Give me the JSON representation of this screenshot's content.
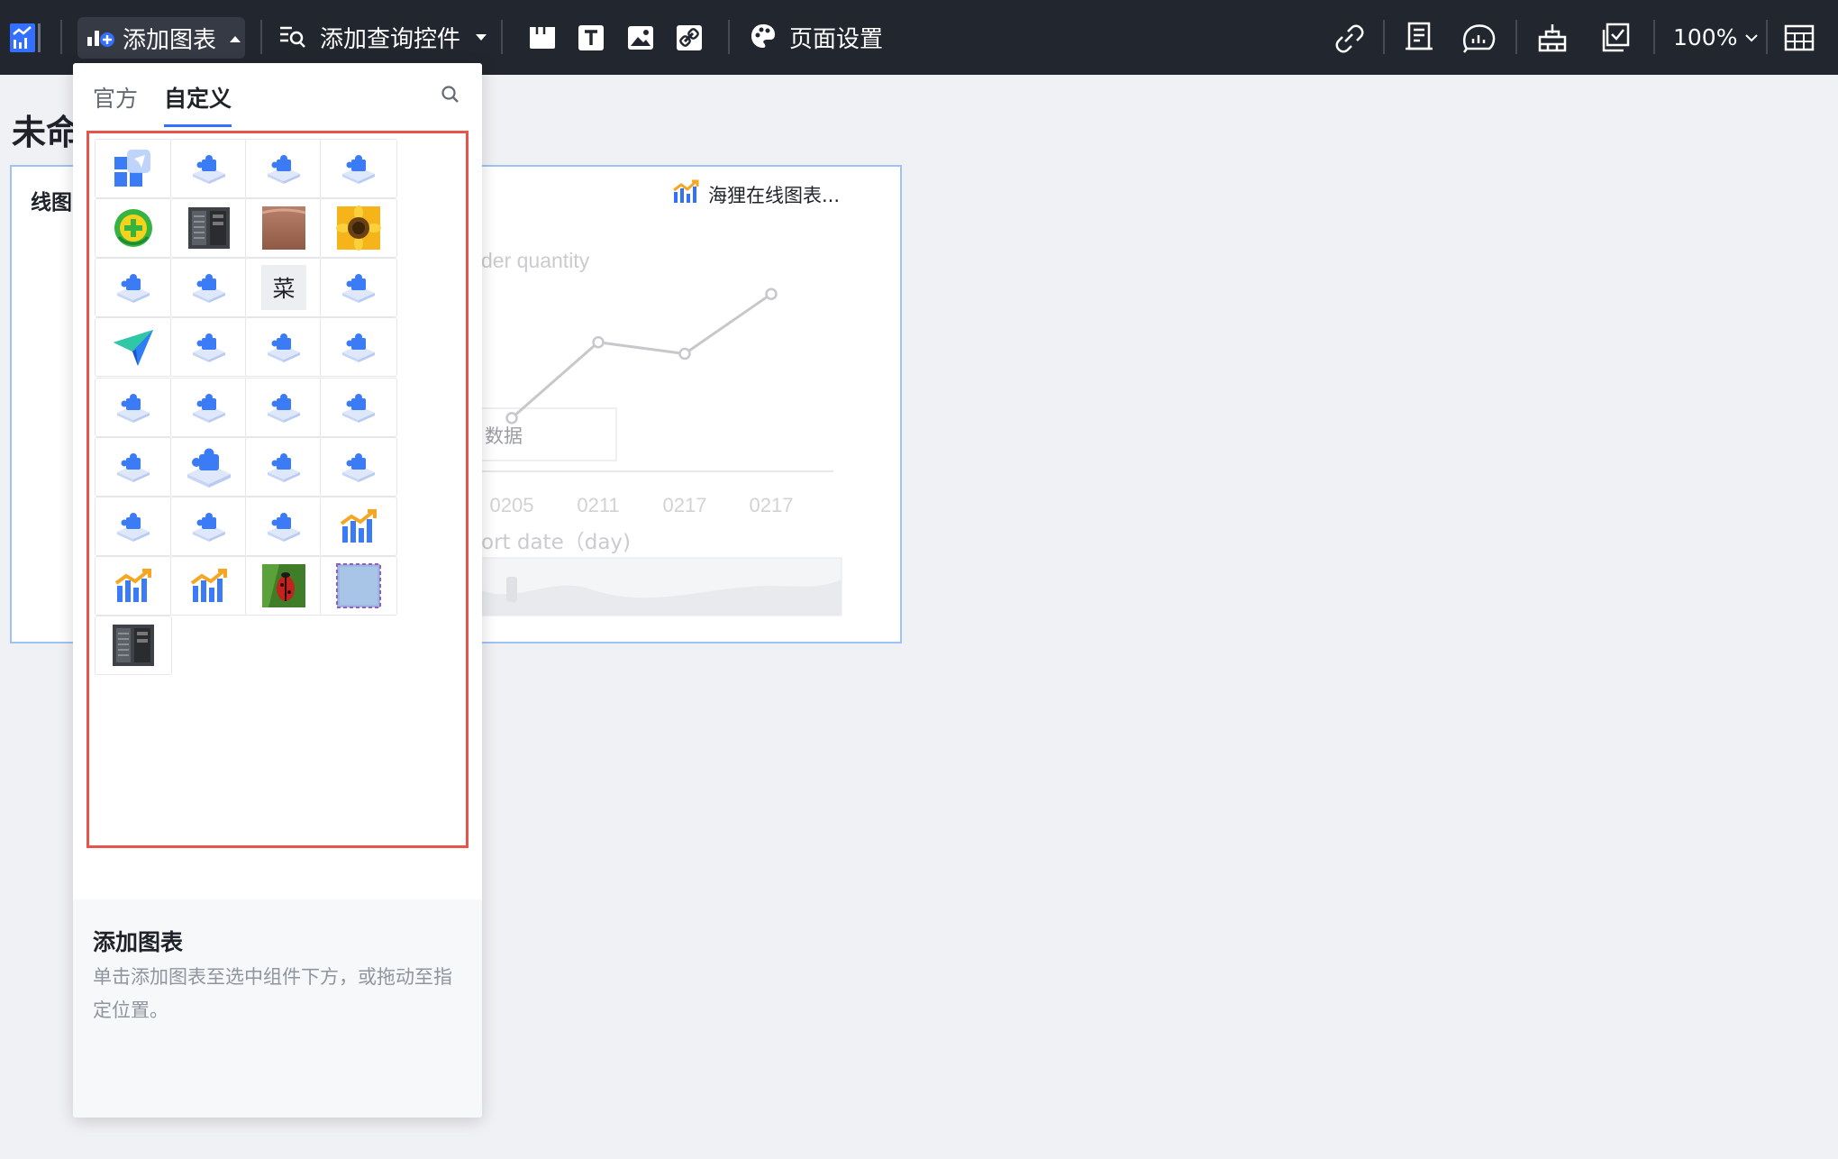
{
  "toolbar": {
    "add_chart_label": "添加图表",
    "add_query_label": "添加查询控件",
    "page_settings_label": "页面设置",
    "zoom": "100%"
  },
  "canvas": {
    "report_title": "未命",
    "card_title": "线图",
    "card_source": "海狸在线图表..."
  },
  "chart_data": {
    "type": "line",
    "title": "",
    "ylabel": "der quantity",
    "xlabel": "ort date（day)",
    "categories": [
      "0205",
      "0211",
      "0217",
      "0217"
    ],
    "values": [
      22,
      55,
      50,
      76
    ],
    "ylim": [
      0,
      100
    ],
    "annotation": "数据",
    "grid": false,
    "legend": "none"
  },
  "panel": {
    "tabs": [
      {
        "label": "官方",
        "active": false
      },
      {
        "label": "自定义",
        "active": true
      }
    ],
    "tiles": [
      {
        "icon": "custom-blocks-icon"
      },
      {
        "icon": "plugin-icon"
      },
      {
        "icon": "plugin-icon"
      },
      {
        "icon": "plugin-icon"
      },
      {
        "icon": "green-plus-circle-icon"
      },
      {
        "icon": "server-photo-icon"
      },
      {
        "icon": "skin-photo-icon"
      },
      {
        "icon": "sunflower-photo-icon"
      },
      {
        "icon": "plugin-icon"
      },
      {
        "icon": "plugin-icon"
      },
      {
        "icon": "text-tile",
        "text": "菜"
      },
      {
        "icon": "plugin-icon"
      },
      {
        "icon": "paper-plane-icon"
      },
      {
        "icon": "plugin-icon"
      },
      {
        "icon": "plugin-icon"
      },
      {
        "icon": "plugin-icon"
      },
      {
        "icon": "plugin-icon"
      },
      {
        "icon": "plugin-icon"
      },
      {
        "icon": "plugin-icon"
      },
      {
        "icon": "plugin-icon"
      },
      {
        "icon": "plugin-icon"
      },
      {
        "icon": "plugin-large-icon"
      },
      {
        "icon": "plugin-icon"
      },
      {
        "icon": "plugin-icon"
      },
      {
        "icon": "plugin-icon"
      },
      {
        "icon": "plugin-icon"
      },
      {
        "icon": "plugin-icon"
      },
      {
        "icon": "bar-trend-chart-icon"
      },
      {
        "icon": "bar-trend-chart-icon"
      },
      {
        "icon": "bar-trend-chart-icon"
      },
      {
        "icon": "ladybug-photo-icon"
      },
      {
        "icon": "blue-square-photo-icon"
      },
      {
        "icon": "server-photo-icon"
      }
    ],
    "footer_title": "添加图表",
    "footer_desc": "单击添加图表至选中组件下方，或拖动至指定位置。"
  },
  "colors": {
    "toolbar_bg": "#22262e",
    "accent": "#3370ff",
    "highlight_border": "#e85449",
    "chart_line": "#c6c8cc"
  }
}
